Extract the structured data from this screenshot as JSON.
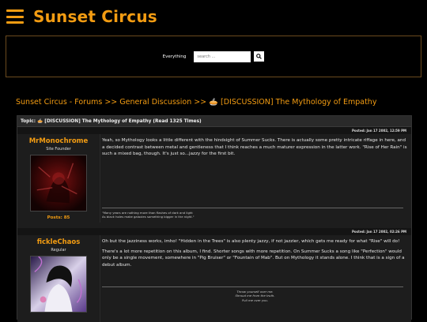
{
  "header": {
    "title": "Sunset Circus"
  },
  "search": {
    "scope": "Everything",
    "placeholder": "search ...",
    "button_icon": "search-icon"
  },
  "breadcrumb": {
    "items": [
      "Sunset Circus - Forums",
      "General Discussion",
      "[DISCUSSION] The Mythology of Empathy"
    ],
    "separator": ">>"
  },
  "topic": {
    "label": "Topic: 🥧 [DISCUSSION] The Mythology of Empathy (Read 1325 Times)"
  },
  "posts": [
    {
      "posted": "Posted: Jan 17 2002, 12:59 PM",
      "author": "MrMonochrome",
      "rank": "Site Founder",
      "post_count": "Posts: 85",
      "body": [
        "Yeah, so Mythology looks a little different with the hindsight of Summer Sucks. There is actually some pretty intricate riffage in here, and a decided contrast between metal and gentleness that I think reaches a much maturer expression in the latter work. \"Rise of Her Rain\" is such a mixed bag, though. It's just so...jazzy for the first bit."
      ],
      "signature": [
        "\"Many years are nothing more than flashes of dark and light",
        "As black holes make galaxies something bigger in the night.\""
      ]
    },
    {
      "posted": "Posted: Jan 17 2002, 02:26 PM",
      "author": "fickleChaos",
      "rank": "Regular",
      "post_count": "",
      "body": [
        "Oh but the jazziness works, imho! \"Hidden in the Trees\" is also plenty jazzy, if not jazzier, which gets me ready for what \"Rise\" will do!",
        "There's a lot more repetition on this album, I find. Shorter songs with more repetition. On Summer Sucks a song like \"Perfection\" would only be a single movement, somewhere in \"Pig Bruiser\" or \"Fountain of Mab\". But on Mythology it stands alone. I think that is a sign of a debut album."
      ],
      "signature": [
        "Throw yourself over me.",
        "Shroud me from the truth.",
        "Pull me over you."
      ]
    }
  ],
  "colors": {
    "accent": "#f39c12",
    "panel": "#1d1d1d",
    "background": "#000000"
  }
}
